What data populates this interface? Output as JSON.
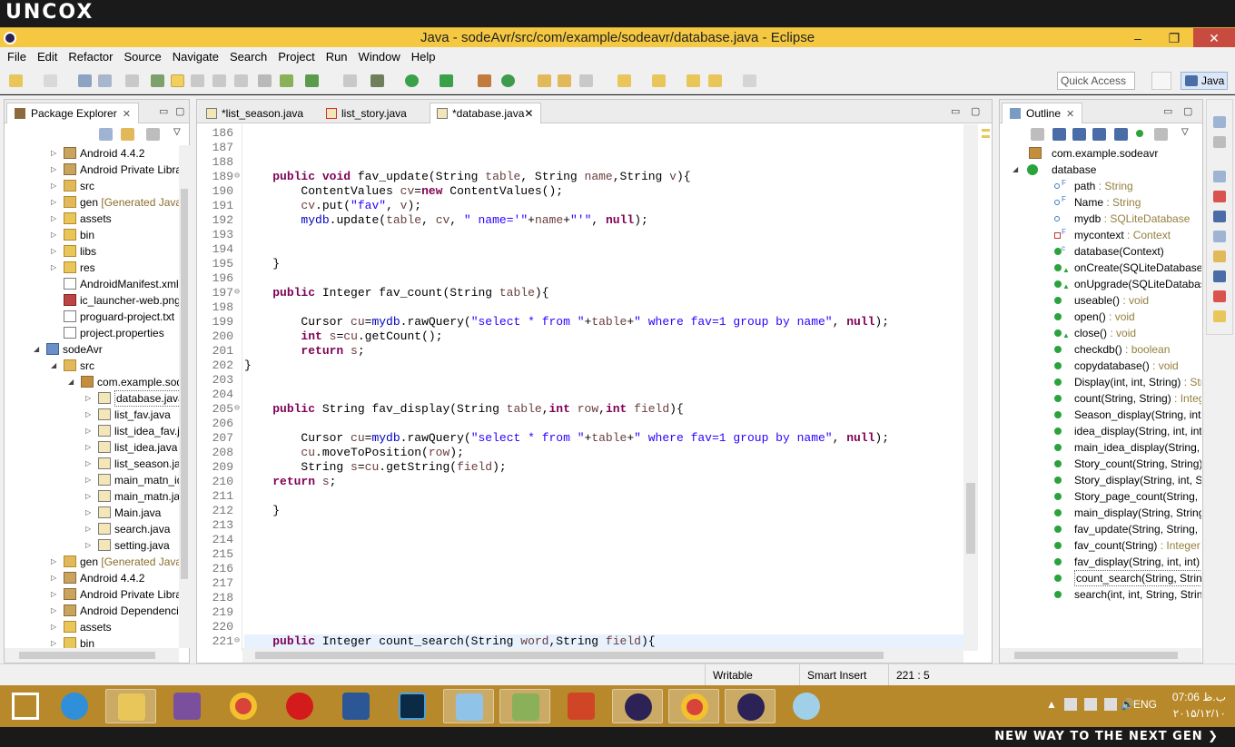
{
  "brand": {
    "top": "UNCOX",
    "bottom": "NEW WAY TO THE NEXT GEN ❯"
  },
  "window": {
    "title": "Java - sodeAvr/src/com/example/sodeavr/database.java - Eclipse",
    "minimize": "–",
    "restore": "❐",
    "close": "✕"
  },
  "menu": [
    "File",
    "Edit",
    "Refactor",
    "Source",
    "Navigate",
    "Search",
    "Project",
    "Run",
    "Window",
    "Help"
  ],
  "toolbar": {
    "quick_access": "Quick Access",
    "perspective": "Java"
  },
  "package_explorer": {
    "title": "Package Explorer",
    "items": [
      {
        "label": "Android 4.4.2",
        "deco": "",
        "indent": 1,
        "twisty": "▷",
        "icon": "library-icon"
      },
      {
        "label": "Android Private Librarie",
        "deco": "",
        "indent": 1,
        "twisty": "▷",
        "icon": "library-icon"
      },
      {
        "label": "src",
        "deco": "",
        "indent": 1,
        "twisty": "▷",
        "icon": "source-folder-icon"
      },
      {
        "label": "gen",
        "deco": "[Generated Java File",
        "indent": 1,
        "twisty": "▷",
        "icon": "source-folder-icon"
      },
      {
        "label": "assets",
        "deco": "",
        "indent": 1,
        "twisty": "▷",
        "icon": "folder-icon"
      },
      {
        "label": "bin",
        "deco": "",
        "indent": 1,
        "twisty": "▷",
        "icon": "folder-icon"
      },
      {
        "label": "libs",
        "deco": "",
        "indent": 1,
        "twisty": "▷",
        "icon": "folder-icon"
      },
      {
        "label": "res",
        "deco": "",
        "indent": 1,
        "twisty": "▷",
        "icon": "folder-icon"
      },
      {
        "label": "AndroidManifest.xml",
        "deco": "",
        "indent": 1,
        "twisty": "",
        "icon": "xml-file-icon"
      },
      {
        "label": "ic_launcher-web.png",
        "deco": "",
        "indent": 1,
        "twisty": "",
        "icon": "image-file-icon"
      },
      {
        "label": "proguard-project.txt",
        "deco": "",
        "indent": 1,
        "twisty": "",
        "icon": "text-file-icon"
      },
      {
        "label": "project.properties",
        "deco": "",
        "indent": 1,
        "twisty": "",
        "icon": "text-file-icon"
      },
      {
        "label": "sodeAvr",
        "deco": "",
        "indent": 0,
        "twisty": "◢",
        "icon": "project-icon"
      },
      {
        "label": "src",
        "deco": "",
        "indent": 1,
        "twisty": "◢",
        "icon": "source-folder-icon"
      },
      {
        "label": "com.example.sodea",
        "deco": "",
        "indent": 2,
        "twisty": "◢",
        "icon": "package-icon"
      },
      {
        "label": "database.java",
        "deco": "",
        "indent": 3,
        "twisty": "▷",
        "icon": "java-file-icon",
        "selected": true
      },
      {
        "label": "list_fav.java",
        "deco": "",
        "indent": 3,
        "twisty": "▷",
        "icon": "java-file-icon"
      },
      {
        "label": "list_idea_fav.java",
        "deco": "",
        "indent": 3,
        "twisty": "▷",
        "icon": "java-file-icon"
      },
      {
        "label": "list_idea.java",
        "deco": "",
        "indent": 3,
        "twisty": "▷",
        "icon": "java-file-icon"
      },
      {
        "label": "list_season.java",
        "deco": "",
        "indent": 3,
        "twisty": "▷",
        "icon": "java-file-icon"
      },
      {
        "label": "main_matn_idea",
        "deco": "",
        "indent": 3,
        "twisty": "▷",
        "icon": "java-file-icon"
      },
      {
        "label": "main_matn.java",
        "deco": "",
        "indent": 3,
        "twisty": "▷",
        "icon": "java-file-icon"
      },
      {
        "label": "Main.java",
        "deco": "",
        "indent": 3,
        "twisty": "▷",
        "icon": "java-file-icon"
      },
      {
        "label": "search.java",
        "deco": "",
        "indent": 3,
        "twisty": "▷",
        "icon": "java-file-icon"
      },
      {
        "label": "setting.java",
        "deco": "",
        "indent": 3,
        "twisty": "▷",
        "icon": "java-file-icon"
      },
      {
        "label": "gen",
        "deco": "[Generated Java File",
        "indent": 1,
        "twisty": "▷",
        "icon": "source-folder-icon"
      },
      {
        "label": "Android 4.4.2",
        "deco": "",
        "indent": 1,
        "twisty": "▷",
        "icon": "library-icon"
      },
      {
        "label": "Android Private Librarie",
        "deco": "",
        "indent": 1,
        "twisty": "▷",
        "icon": "library-icon"
      },
      {
        "label": "Android Dependencies",
        "deco": "",
        "indent": 1,
        "twisty": "▷",
        "icon": "library-icon"
      },
      {
        "label": "assets",
        "deco": "",
        "indent": 1,
        "twisty": "▷",
        "icon": "folder-icon"
      },
      {
        "label": "bin",
        "deco": "",
        "indent": 1,
        "twisty": "▷",
        "icon": "folder-icon"
      }
    ]
  },
  "editor": {
    "tabs": [
      {
        "label": "*list_season.java",
        "active": false,
        "error": false
      },
      {
        "label": "list_story.java",
        "active": false,
        "error": true
      },
      {
        "label": "*database.java",
        "active": true,
        "error": false
      }
    ],
    "lines": [
      {
        "n": "186",
        "fold": "",
        "html": ""
      },
      {
        "n": "187",
        "fold": "",
        "html": ""
      },
      {
        "n": "188",
        "fold": "",
        "html": ""
      },
      {
        "n": "189",
        "fold": "⊖",
        "html": "    <span class='kw'>public</span> <span class='kw'>void</span> fav_update(String <span class='par'>table</span>, String <span class='par'>name</span>,String <span class='par'>v</span>){"
      },
      {
        "n": "190",
        "fold": "",
        "html": "        ContentValues <span class='par'>cv</span>=<span class='kw'>new</span> ContentValues();"
      },
      {
        "n": "191",
        "fold": "",
        "html": "        <span class='par'>cv</span>.put(<span class='str'>\"fav\"</span>, <span class='par'>v</span>);"
      },
      {
        "n": "192",
        "fold": "",
        "html": "        <span class='fld'>mydb</span>.update(<span class='par'>table</span>, <span class='par'>cv</span>, <span class='str'>\" name='\"</span>+<span class='par'>name</span>+<span class='str'>\"'\"</span>, <span class='kw'>null</span>);"
      },
      {
        "n": "193",
        "fold": "",
        "html": ""
      },
      {
        "n": "194",
        "fold": "",
        "html": ""
      },
      {
        "n": "195",
        "fold": "",
        "html": "    }"
      },
      {
        "n": "196",
        "fold": "",
        "html": ""
      },
      {
        "n": "197",
        "fold": "⊖",
        "html": "    <span class='kw'>public</span> Integer fav_count(String <span class='par'>table</span>){"
      },
      {
        "n": "198",
        "fold": "",
        "html": ""
      },
      {
        "n": "199",
        "fold": "",
        "html": "        Cursor <span class='par'>cu</span>=<span class='fld'>mydb</span>.rawQuery(<span class='str'>\"select * from \"</span>+<span class='par'>table</span>+<span class='str'>\" where fav=1 group by name\"</span>, <span class='kw'>null</span>);"
      },
      {
        "n": "200",
        "fold": "",
        "html": "        <span class='kw'>int</span> <span class='par'>s</span>=<span class='par'>cu</span>.getCount();"
      },
      {
        "n": "201",
        "fold": "",
        "html": "        <span class='kw'>return</span> <span class='par'>s</span>;"
      },
      {
        "n": "202",
        "fold": "",
        "html": "}"
      },
      {
        "n": "203",
        "fold": "",
        "html": ""
      },
      {
        "n": "204",
        "fold": "",
        "html": ""
      },
      {
        "n": "205",
        "fold": "⊖",
        "html": "    <span class='kw'>public</span> String fav_display(String <span class='par'>table</span>,<span class='kw'>int</span> <span class='par'>row</span>,<span class='kw'>int</span> <span class='par'>field</span>){"
      },
      {
        "n": "206",
        "fold": "",
        "html": ""
      },
      {
        "n": "207",
        "fold": "",
        "html": "        Cursor <span class='par'>cu</span>=<span class='fld'>mydb</span>.rawQuery(<span class='str'>\"select * from \"</span>+<span class='par'>table</span>+<span class='str'>\" where fav=1 group by name\"</span>, <span class='kw'>null</span>);"
      },
      {
        "n": "208",
        "fold": "",
        "html": "        <span class='par'>cu</span>.moveToPosition(<span class='par'>row</span>);"
      },
      {
        "n": "209",
        "fold": "",
        "html": "        String <span class='par'>s</span>=<span class='par'>cu</span>.getString(<span class='par'>field</span>);"
      },
      {
        "n": "210",
        "fold": "",
        "html": "    <span class='kw'>return</span> <span class='par'>s</span>;"
      },
      {
        "n": "211",
        "fold": "",
        "html": ""
      },
      {
        "n": "212",
        "fold": "",
        "html": "    }"
      },
      {
        "n": "213",
        "fold": "",
        "html": ""
      },
      {
        "n": "214",
        "fold": "",
        "html": ""
      },
      {
        "n": "215",
        "fold": "",
        "html": ""
      },
      {
        "n": "216",
        "fold": "",
        "html": ""
      },
      {
        "n": "217",
        "fold": "",
        "html": ""
      },
      {
        "n": "218",
        "fold": "",
        "html": ""
      },
      {
        "n": "219",
        "fold": "",
        "html": ""
      },
      {
        "n": "220",
        "fold": "",
        "html": ""
      },
      {
        "n": "221",
        "fold": "⊖",
        "html": "    <span class='kw'>public</span> Integer count_search(String <span class='par'>word</span>,String <span class='par'>field</span>){",
        "current": true
      }
    ]
  },
  "outline": {
    "title": "Outline",
    "items": [
      {
        "name": "com.example.sodeavr",
        "type": "",
        "indent": 0,
        "icon": "import-icon",
        "vis": ""
      },
      {
        "name": "database",
        "type": "",
        "indent": 0,
        "icon": "class-icon",
        "vis": "",
        "twisty": "◢"
      },
      {
        "name": "path",
        "type": " : String",
        "indent": 1,
        "icon": "field-icon",
        "vis": "default",
        "sup": "F"
      },
      {
        "name": "Name",
        "type": " : String",
        "indent": 1,
        "icon": "field-icon",
        "vis": "default",
        "sup": "F"
      },
      {
        "name": "mydb",
        "type": " : SQLiteDatabase",
        "indent": 1,
        "icon": "field-icon",
        "vis": "default"
      },
      {
        "name": "mycontext",
        "type": " : Context",
        "indent": 1,
        "icon": "field-icon",
        "vis": "private",
        "sup": "F"
      },
      {
        "name": "database(Context)",
        "type": "",
        "indent": 1,
        "icon": "constructor-icon",
        "vis": "public",
        "sup": "c"
      },
      {
        "name": "onCreate(SQLiteDatabase)",
        "type": "",
        "indent": 1,
        "icon": "method-icon",
        "vis": "public",
        "tri": true
      },
      {
        "name": "onUpgrade(SQLiteDatabas",
        "type": "",
        "indent": 1,
        "icon": "method-icon",
        "vis": "public",
        "tri": true
      },
      {
        "name": "useable()",
        "type": " : void",
        "indent": 1,
        "icon": "method-icon",
        "vis": "public"
      },
      {
        "name": "open()",
        "type": " : void",
        "indent": 1,
        "icon": "method-icon",
        "vis": "public"
      },
      {
        "name": "close()",
        "type": " : void",
        "indent": 1,
        "icon": "method-icon",
        "vis": "public",
        "tri": true
      },
      {
        "name": "checkdb()",
        "type": " : boolean",
        "indent": 1,
        "icon": "method-icon",
        "vis": "public"
      },
      {
        "name": "copydatabase()",
        "type": " : void",
        "indent": 1,
        "icon": "method-icon",
        "vis": "public"
      },
      {
        "name": "Display(int, int, String)",
        "type": " : Stri",
        "indent": 1,
        "icon": "method-icon",
        "vis": "public"
      },
      {
        "name": "count(String, String)",
        "type": " : Integ",
        "indent": 1,
        "icon": "method-icon",
        "vis": "public"
      },
      {
        "name": "Season_display(String, int,",
        "type": "",
        "indent": 1,
        "icon": "method-icon",
        "vis": "public"
      },
      {
        "name": "idea_display(String, int, int",
        "type": "",
        "indent": 1,
        "icon": "method-icon",
        "vis": "public"
      },
      {
        "name": "main_idea_display(String, S",
        "type": "",
        "indent": 1,
        "icon": "method-icon",
        "vis": "public"
      },
      {
        "name": "Story_count(String, String)",
        "type": "",
        "indent": 1,
        "icon": "method-icon",
        "vis": "public"
      },
      {
        "name": "Story_display(String, int, St",
        "type": "",
        "indent": 1,
        "icon": "method-icon",
        "vis": "public"
      },
      {
        "name": "Story_page_count(String, S",
        "type": "",
        "indent": 1,
        "icon": "method-icon",
        "vis": "public"
      },
      {
        "name": "main_display(String, String",
        "type": "",
        "indent": 1,
        "icon": "method-icon",
        "vis": "public"
      },
      {
        "name": "fav_update(String, String, S",
        "type": "",
        "indent": 1,
        "icon": "method-icon",
        "vis": "public"
      },
      {
        "name": "fav_count(String)",
        "type": " : Integer",
        "indent": 1,
        "icon": "method-icon",
        "vis": "public"
      },
      {
        "name": "fav_display(String, int, int)",
        "type": "",
        "indent": 1,
        "icon": "method-icon",
        "vis": "public"
      },
      {
        "name": "count_search(String, String",
        "type": "",
        "indent": 1,
        "icon": "method-icon",
        "vis": "public",
        "selected": true
      },
      {
        "name": "search(int, int, String, Strin",
        "type": "",
        "indent": 1,
        "icon": "method-icon",
        "vis": "public"
      }
    ]
  },
  "status": {
    "writable": "Writable",
    "insert_mode": "Smart Insert",
    "position": "221 : 5"
  },
  "taskbar": {
    "apps": [
      "start-icon",
      "internet-explorer-icon",
      "file-explorer-icon",
      "visual-studio-icon",
      "chrome-icon",
      "opera-icon",
      "word-icon",
      "photoshop-icon",
      "notepad-icon",
      "android-sdk-icon",
      "powerpoint-icon",
      "eclipse-icon",
      "chrome-icon",
      "eclipse-icon",
      "paint-icon"
    ],
    "lang": "ENG",
    "time": "07:06 ب.ظ",
    "date": "۲۰۱۵/۱۲/۱۰"
  },
  "colors": {
    "titlebar": "#f5c842",
    "taskbar": "#b8892a",
    "keyword": "#7f0055",
    "string": "#2a00ff",
    "field": "#0000c0"
  }
}
